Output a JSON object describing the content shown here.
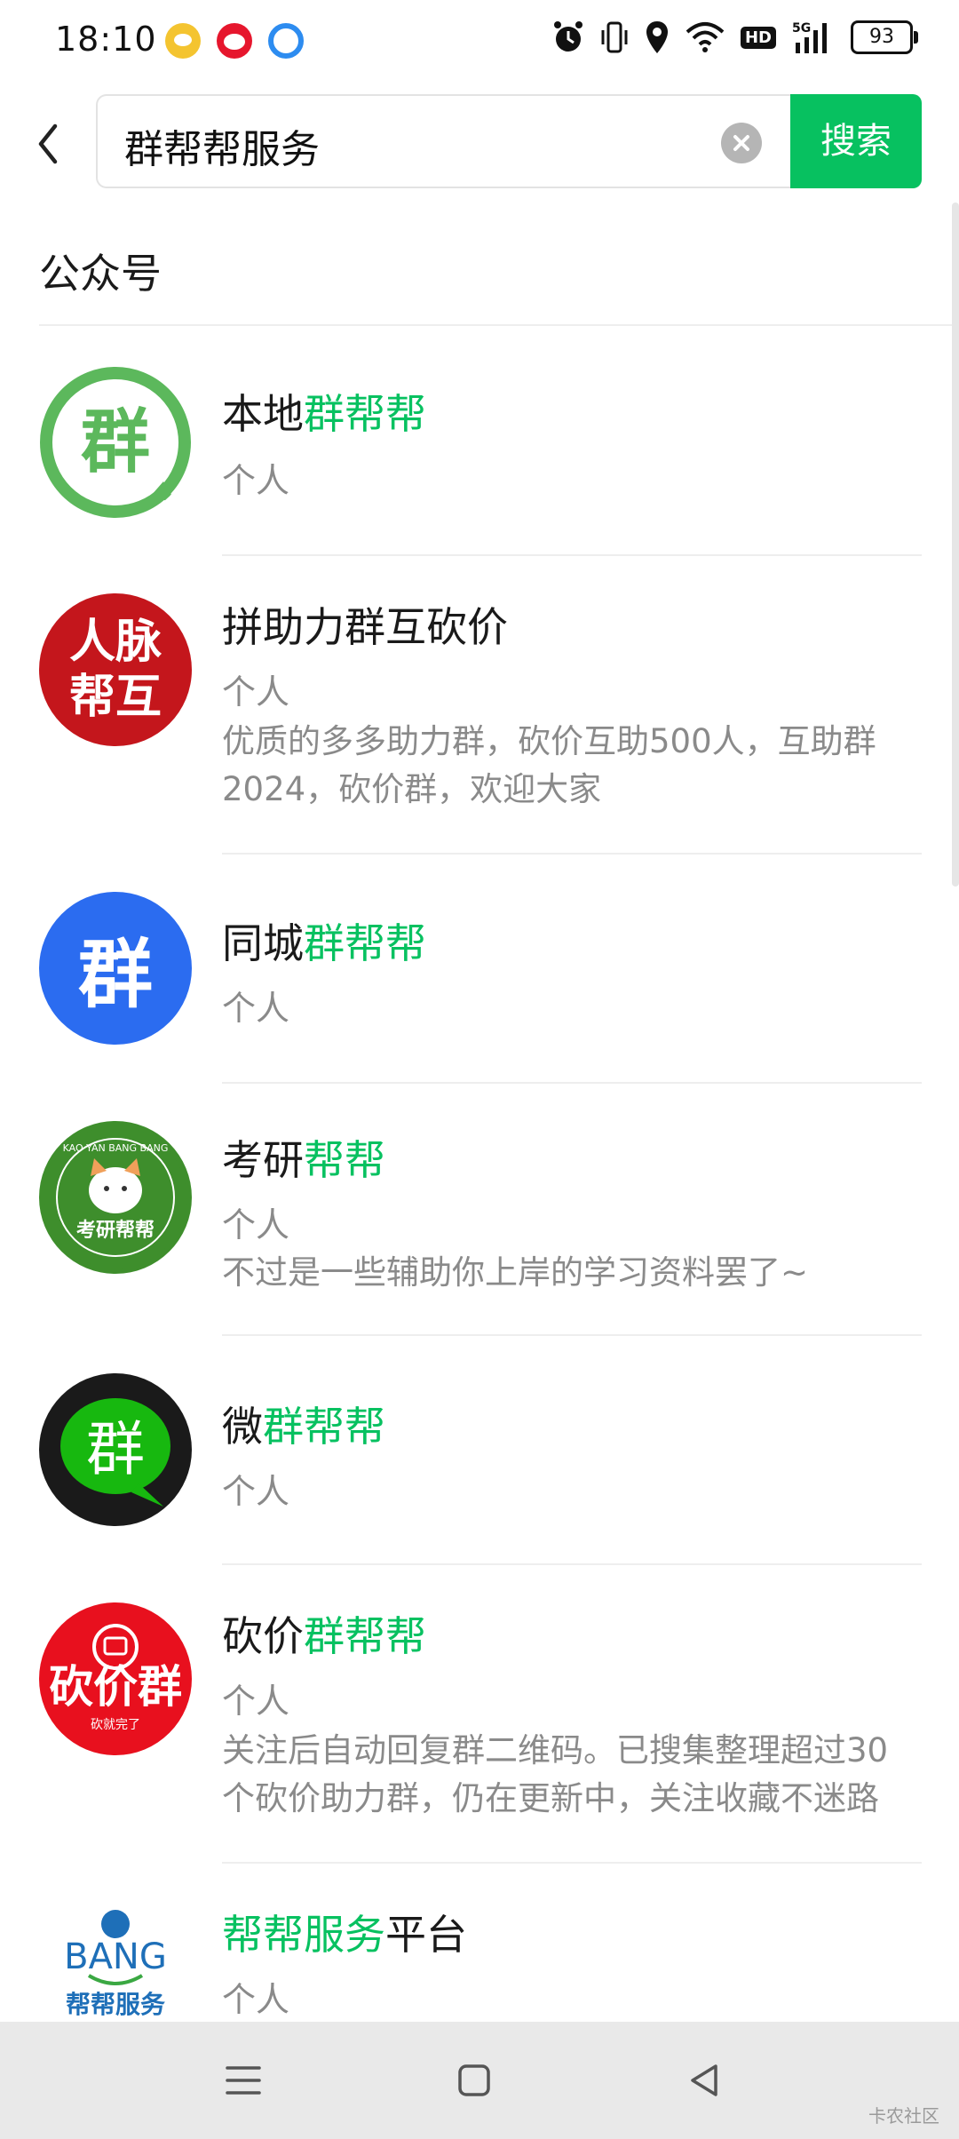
{
  "status_bar": {
    "time": "18:10",
    "battery": "93",
    "network": "5G",
    "hd": "HD",
    "icons": [
      "alarm-icon",
      "vibrate-icon",
      "location-icon",
      "wifi-icon",
      "hd-icon",
      "signal-icon",
      "battery-icon"
    ]
  },
  "search": {
    "query": "群帮帮服务",
    "button_label": "搜索"
  },
  "section": {
    "title": "公众号"
  },
  "results": [
    {
      "title_prefix": "本地",
      "title_highlight": "群帮帮",
      "title_suffix": "",
      "type": "个人",
      "description": "",
      "avatar_text": "群",
      "avatar_color": "#5cb85c"
    },
    {
      "title_prefix": "拼助力群互砍价",
      "title_highlight": "",
      "title_suffix": "",
      "type": "个人",
      "description": "优质的多多助力群，砍价互助500人，互助群2024，砍价群，欢迎大家",
      "avatar_text_1": "人脉",
      "avatar_text_2": "帮互",
      "avatar_color": "#c4161c"
    },
    {
      "title_prefix": "同城",
      "title_highlight": "群帮帮",
      "title_suffix": "",
      "type": "个人",
      "description": "",
      "avatar_text": "群",
      "avatar_color": "#2b6cf0"
    },
    {
      "title_prefix": "考研",
      "title_highlight": "帮帮",
      "title_suffix": "",
      "type": "个人",
      "description": "不过是一些辅助你上岸的学习资料罢了~",
      "avatar_text": "考研帮帮",
      "avatar_ring_text": "KAO YAN BANG BANG",
      "avatar_color": "#3e8e2c"
    },
    {
      "title_prefix": "微",
      "title_highlight": "群帮帮",
      "title_suffix": "",
      "type": "个人",
      "description": "",
      "avatar_text": "群",
      "avatar_color": "#1a1a1a",
      "bubble_color": "#17b80f"
    },
    {
      "title_prefix": "砍价",
      "title_highlight": "群帮帮",
      "title_suffix": "",
      "type": "个人",
      "description": "关注后自动回复群二维码。已搜集整理超过30个砍价助力群，仍在更新中，关注收藏不迷路",
      "avatar_text": "砍价群",
      "avatar_subtext": "砍就完了",
      "avatar_color": "#e8101e"
    },
    {
      "title_prefix": "",
      "title_highlight": "帮帮服务",
      "title_suffix": "平台",
      "type": "个人",
      "description": "",
      "avatar_text": "BANG",
      "avatar_subtext": "帮帮服务",
      "avatar_color": "#1e6fb8"
    }
  ],
  "watermark": "卡农社区",
  "colors": {
    "accent": "#07c160",
    "text_primary": "#1a1a1a",
    "text_secondary": "#8a8a8a",
    "divider": "#eeeeee"
  }
}
